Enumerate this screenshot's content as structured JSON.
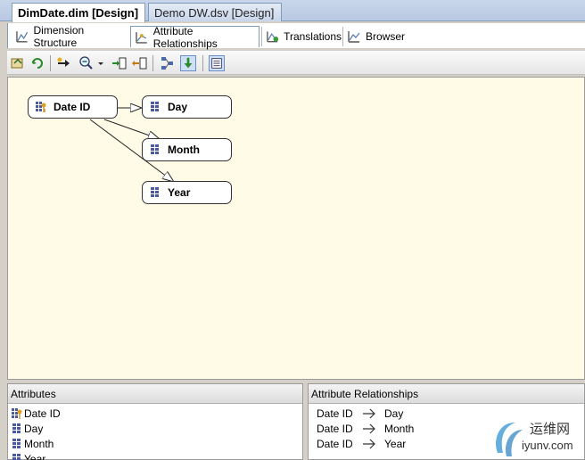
{
  "document_tabs": [
    {
      "label": "DimDate.dim [Design]",
      "active": true
    },
    {
      "label": "Demo DW.dsv [Design]",
      "active": false
    }
  ],
  "designer_tabs": [
    {
      "label": "Dimension Structure",
      "icon": "dimension-structure-icon"
    },
    {
      "label": "Attribute Relationships",
      "icon": "attribute-relationships-icon",
      "active": true
    },
    {
      "label": "Translations",
      "icon": "translations-icon"
    },
    {
      "label": "Browser",
      "icon": "browser-icon"
    }
  ],
  "toolbar": {
    "buttons": [
      "process-icon",
      "refresh-icon",
      "new-relationship-icon",
      "zoom-icon",
      "zoom-dropdown-icon",
      "expand-icon",
      "collapse-icon",
      "arrange-icon",
      "fit-icon",
      "show-list-icon"
    ]
  },
  "diagram": {
    "nodes": [
      {
        "id": "date_id",
        "label": "Date ID",
        "key": true
      },
      {
        "id": "day",
        "label": "Day"
      },
      {
        "id": "month",
        "label": "Month"
      },
      {
        "id": "year",
        "label": "Year"
      }
    ],
    "edges": [
      {
        "from": "date_id",
        "to": "day"
      },
      {
        "from": "date_id",
        "to": "month"
      },
      {
        "from": "date_id",
        "to": "year"
      }
    ]
  },
  "attributes_pane": {
    "title": "Attributes",
    "items": [
      "Date ID",
      "Day",
      "Month",
      "Year"
    ]
  },
  "relationships_pane": {
    "title": "Attribute Relationships",
    "rows": [
      {
        "from": "Date ID",
        "to": "Day"
      },
      {
        "from": "Date ID",
        "to": "Month"
      },
      {
        "from": "Date ID",
        "to": "Year"
      }
    ]
  },
  "watermark": {
    "chinese": "运维网",
    "url": "iyunv.com"
  },
  "colors": {
    "diagram_bg": "#fffbe6",
    "tab_border": "#7f9db9",
    "node_border": "#333333"
  }
}
